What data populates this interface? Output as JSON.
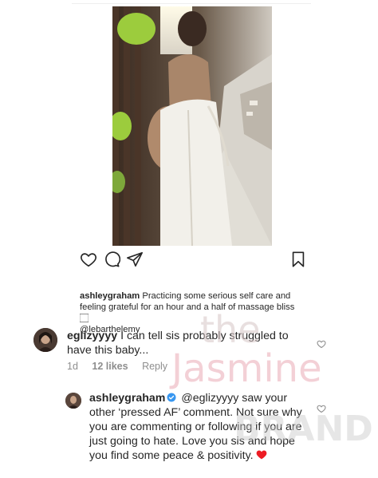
{
  "post": {
    "caption": {
      "username": "ashleygraham",
      "text": "Practicing some serious self care and feeling grateful for an hour and a half of massage bliss",
      "emoji": "🏻",
      "mention": "@lebarthelemy"
    }
  },
  "comments": [
    {
      "username": "eglizyyyy",
      "text": "I can tell sis probably struggled to have this baby...",
      "time": "1d",
      "likes": "12 likes",
      "reply": "Reply"
    },
    {
      "username": "ashleygraham",
      "text": "@eglizyyyy saw your other ‘pressed AF’ comment. Not sure why you are commenting or following if you are just going to hate. Love you sis and hope you find some peace & positivity."
    }
  ],
  "watermark": {
    "line1": "the",
    "line2": "Jasmine",
    "line3": "BRAND"
  },
  "colors": {
    "verified": "#3897f0",
    "heart_red": "#ed1c24",
    "meta_gray": "#8e8e8e"
  }
}
